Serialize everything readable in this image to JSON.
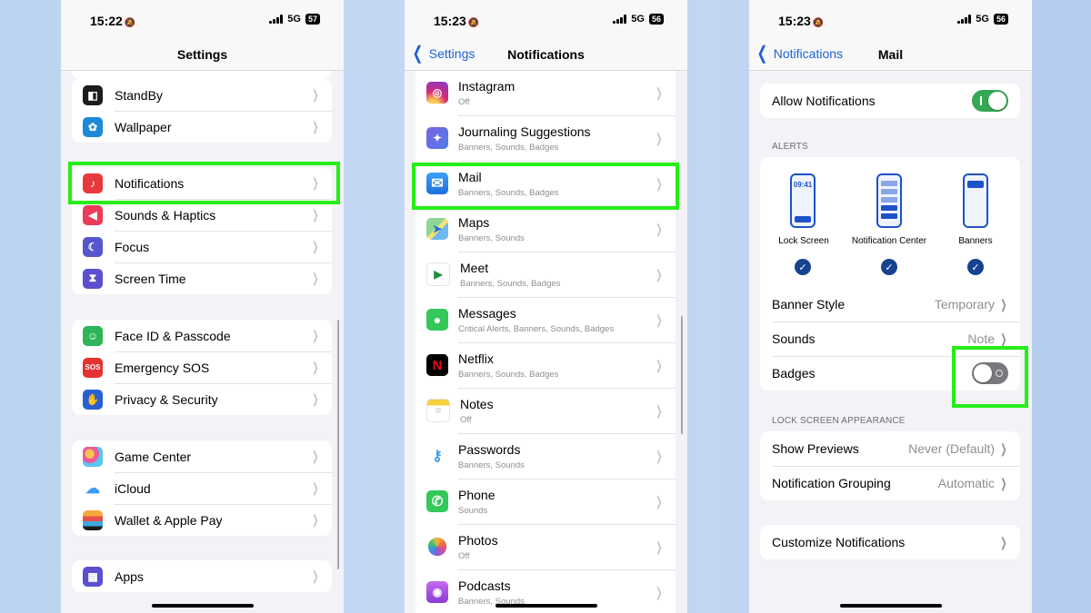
{
  "colors": {
    "highlight": "#25ee18",
    "ios_blue": "#1c62d6",
    "toggle_on": "#34a853"
  },
  "screen1": {
    "status": {
      "time": "15:22",
      "network": "5G",
      "battery": "57"
    },
    "title": "Settings",
    "groups": [
      {
        "items": [
          {
            "label": "StandBy",
            "icon": "standby-icon",
            "color": "#1c1c1e",
            "glyph": "◧"
          },
          {
            "label": "Wallpaper",
            "icon": "wallpaper-icon",
            "color": "#1c8ad8",
            "glyph": "✿"
          }
        ]
      },
      {
        "items": [
          {
            "label": "Notifications",
            "icon": "notifications-icon",
            "color": "#e8393c",
            "glyph": "🔔"
          },
          {
            "label": "Sounds & Haptics",
            "icon": "sounds-icon",
            "color": "#ea3b58",
            "glyph": "🔊"
          },
          {
            "label": "Focus",
            "icon": "focus-moon-icon",
            "color": "#5756cf",
            "glyph": "☾"
          },
          {
            "label": "Screen Time",
            "icon": "screen-time-icon",
            "color": "#5b4fd0",
            "glyph": "⧗"
          }
        ]
      },
      {
        "items": [
          {
            "label": "Face ID & Passcode",
            "icon": "face-id-icon",
            "color": "#2fb457",
            "glyph": "☺"
          },
          {
            "label": "Emergency SOS",
            "icon": "sos-icon",
            "color": "#e3322f",
            "glyph": "SOS"
          },
          {
            "label": "Privacy & Security",
            "icon": "privacy-hand-icon",
            "color": "#2a5fd3",
            "glyph": "✋"
          }
        ]
      },
      {
        "items": [
          {
            "label": "Game Center",
            "icon": "game-center-icon",
            "color": "#ffffff",
            "glyph": "●"
          },
          {
            "label": "iCloud",
            "icon": "icloud-icon",
            "color": "#ffffff",
            "glyph": "☁"
          },
          {
            "label": "Wallet & Apple Pay",
            "icon": "wallet-icon",
            "color": "#1c1c1e",
            "glyph": "▤"
          }
        ]
      },
      {
        "items": [
          {
            "label": "Apps",
            "icon": "apps-grid-icon",
            "color": "#5a4fd0",
            "glyph": "▦"
          }
        ]
      }
    ]
  },
  "screen2": {
    "status": {
      "time": "15:23",
      "network": "5G",
      "battery": "56"
    },
    "back_label": "Settings",
    "title": "Notifications",
    "apps": [
      {
        "name": "Instagram",
        "sub": "Off",
        "icon": "instagram-icon",
        "color": "#d62976",
        "glyph": "◎"
      },
      {
        "name": "Journaling Suggestions",
        "sub": "Banners, Sounds, Badges",
        "icon": "journaling-icon",
        "color": "#6a5bd6",
        "glyph": "✦"
      },
      {
        "name": "Mail",
        "sub": "Banners, Sounds, Badges",
        "icon": "mail-icon",
        "color": "#2a8cf0",
        "glyph": "✉"
      },
      {
        "name": "Maps",
        "sub": "Banners, Sounds",
        "icon": "maps-icon",
        "color": "#5fb86a",
        "glyph": "➤"
      },
      {
        "name": "Meet",
        "sub": "Banners, Sounds, Badges",
        "icon": "meet-icon",
        "color": "#ffffff",
        "glyph": "▶"
      },
      {
        "name": "Messages",
        "sub": "Critical Alerts, Banners, Sounds, Badges",
        "icon": "messages-icon",
        "color": "#34c759",
        "glyph": "💬"
      },
      {
        "name": "Netflix",
        "sub": "Banners, Sounds, Badges",
        "icon": "netflix-icon",
        "color": "#000000",
        "glyph": "N"
      },
      {
        "name": "Notes",
        "sub": "Off",
        "icon": "notes-icon",
        "color": "#ffffff",
        "glyph": "≡"
      },
      {
        "name": "Passwords",
        "sub": "Banners, Sounds",
        "icon": "passwords-icon",
        "color": "#ffffff",
        "glyph": "⚷"
      },
      {
        "name": "Phone",
        "sub": "Sounds",
        "icon": "phone-icon",
        "color": "#34c759",
        "glyph": "✆"
      },
      {
        "name": "Photos",
        "sub": "Off",
        "icon": "photos-icon",
        "color": "#ffffff",
        "glyph": "✿"
      },
      {
        "name": "Podcasts",
        "sub": "Banners, Sounds",
        "icon": "podcasts-icon",
        "color": "#a24fd8",
        "glyph": "◉"
      }
    ]
  },
  "screen3": {
    "status": {
      "time": "15:23",
      "network": "5G",
      "battery": "56"
    },
    "back_label": "Notifications",
    "title": "Mail",
    "allow_label": "Allow Notifications",
    "allow_on": true,
    "alerts_header": "ALERTS",
    "alert_styles": [
      {
        "label": "Lock Screen",
        "preview_time": "09:41",
        "checked": true
      },
      {
        "label": "Notification Center",
        "checked": true
      },
      {
        "label": "Banners",
        "checked": true
      }
    ],
    "banner_style_label": "Banner Style",
    "banner_style_value": "Temporary",
    "sounds_label": "Sounds",
    "sounds_value": "Note",
    "badges_label": "Badges",
    "badges_on": false,
    "lock_header": "LOCK SCREEN APPEARANCE",
    "show_previews_label": "Show Previews",
    "show_previews_value": "Never (Default)",
    "grouping_label": "Notification Grouping",
    "grouping_value": "Automatic",
    "customize_label": "Customize Notifications"
  }
}
